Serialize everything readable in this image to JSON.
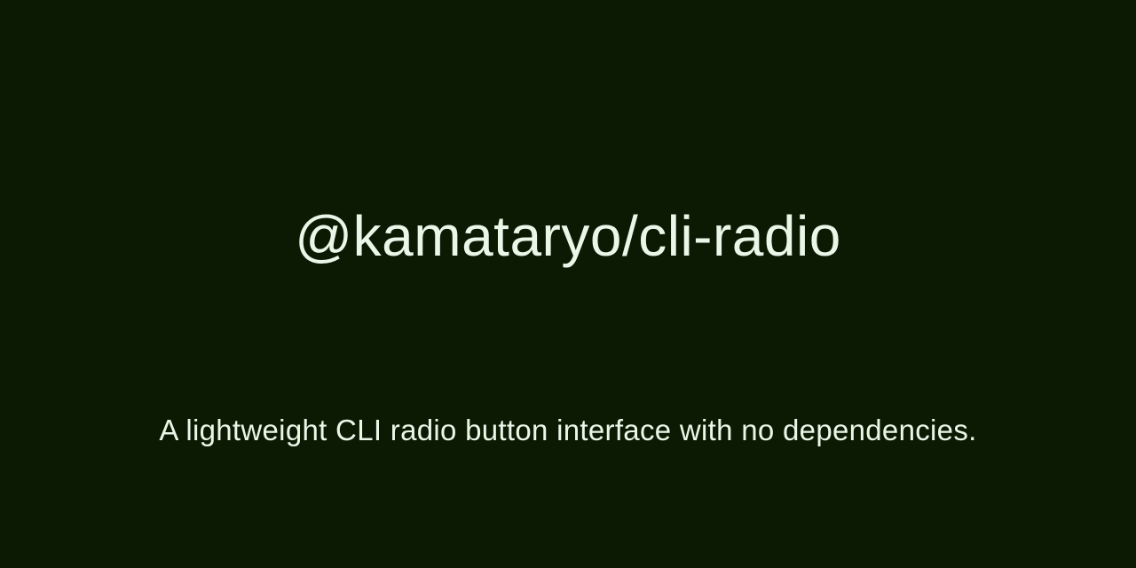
{
  "card": {
    "title": "@kamataryo/cli-radio",
    "subtitle": "A lightweight CLI radio button interface with no dependencies."
  },
  "colors": {
    "background": "#0d1a03",
    "text": "#e8f7e8"
  }
}
